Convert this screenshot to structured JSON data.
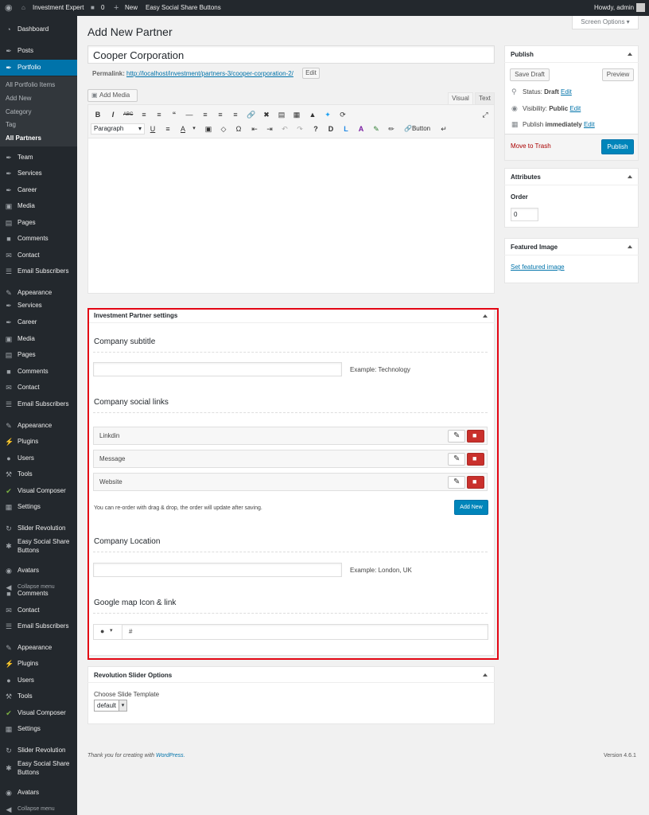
{
  "adminbar": {
    "site_name": "Investment Expert",
    "comments_count": "0",
    "new_label": "New",
    "plugin_link": "Easy Social Share Buttons",
    "howdy": "Howdy, admin"
  },
  "sidebar": {
    "items": [
      {
        "label": "Dashboard",
        "icon": "dashboard-icon"
      },
      {
        "label": "Posts",
        "icon": "pin-icon"
      },
      {
        "label": "Portfolio",
        "icon": "pin-icon"
      },
      {
        "label": "Team",
        "icon": "pin-icon"
      },
      {
        "label": "Services",
        "icon": "pin-icon"
      },
      {
        "label": "Career",
        "icon": "pin-icon"
      },
      {
        "label": "Media",
        "icon": "media-icon"
      },
      {
        "label": "Pages",
        "icon": "pages-icon"
      },
      {
        "label": "Comments",
        "icon": "comments-icon"
      },
      {
        "label": "Contact",
        "icon": "mail-icon"
      },
      {
        "label": "Email Subscribers",
        "icon": "list-icon"
      },
      {
        "label": "Appearance",
        "icon": "brush-icon"
      },
      {
        "label": "Services",
        "icon": "pin-icon"
      },
      {
        "label": "Career",
        "icon": "pin-icon"
      },
      {
        "label": "Media",
        "icon": "media-icon"
      },
      {
        "label": "Pages",
        "icon": "pages-icon"
      },
      {
        "label": "Comments",
        "icon": "comments-icon"
      },
      {
        "label": "Contact",
        "icon": "mail-icon"
      },
      {
        "label": "Email Subscribers",
        "icon": "list-icon"
      },
      {
        "label": "Appearance",
        "icon": "brush-icon"
      },
      {
        "label": "Plugins",
        "icon": "plug-icon"
      },
      {
        "label": "Users",
        "icon": "user-icon"
      },
      {
        "label": "Tools",
        "icon": "wrench-icon"
      },
      {
        "label": "Visual Composer",
        "icon": "vc-icon"
      },
      {
        "label": "Settings",
        "icon": "settings-icon"
      },
      {
        "label": "Slider Revolution",
        "icon": "refresh-icon"
      },
      {
        "label": "Easy Social Share",
        "label2": "Buttons",
        "icon": "share-icon"
      },
      {
        "label": "Avatars",
        "icon": "avatar-icon"
      },
      {
        "label": "Collapse menu",
        "icon": "collapse-icon"
      },
      {
        "label": "Comments",
        "icon": "comments-icon"
      },
      {
        "label": "Contact",
        "icon": "mail-icon"
      },
      {
        "label": "Email Subscribers",
        "icon": "list-icon"
      },
      {
        "label": "Appearance",
        "icon": "brush-icon"
      },
      {
        "label": "Plugins",
        "icon": "plug-icon"
      },
      {
        "label": "Users",
        "icon": "user-icon"
      },
      {
        "label": "Tools",
        "icon": "wrench-icon"
      },
      {
        "label": "Visual Composer",
        "icon": "vc-icon"
      },
      {
        "label": "Settings",
        "icon": "settings-icon"
      },
      {
        "label": "Slider Revolution",
        "icon": "refresh-icon"
      },
      {
        "label": "Easy Social Share",
        "label2": "Buttons",
        "icon": "share-icon"
      },
      {
        "label": "Avatars",
        "icon": "avatar-icon"
      },
      {
        "label": "Collapse menu",
        "icon": "collapse-icon"
      }
    ],
    "portfolio_sub": [
      "All Portfolio Items",
      "Add New",
      "Category",
      "Tag",
      "All Partners"
    ]
  },
  "page": {
    "title": "Add New Partner",
    "screen_options": "Screen Options"
  },
  "editor": {
    "post_title": "Cooper Corporation",
    "permalink_label": "Permalink:",
    "permalink_url": "http://localhost/investment/partners-3/cooper-corporation-2/",
    "edit_btn": "Edit",
    "add_media": "Add Media",
    "tab_visual": "Visual",
    "tab_text": "Text",
    "format_select": "Paragraph",
    "button_label": "Button"
  },
  "partner_settings": {
    "title": "Investment Partner settings",
    "subtitle_heading": "Company subtitle",
    "subtitle_value": "",
    "subtitle_example": "Example: Technology",
    "social_heading": "Company social links",
    "social_links": [
      "Linkdin",
      "Message",
      "Website"
    ],
    "reorder_note": "You can re-order with drag & drop, the order will update after saving.",
    "add_new": "Add New",
    "location_heading": "Company Location",
    "location_value": "",
    "location_example": "Example: London, UK",
    "map_heading": "Google map Icon & link",
    "map_link_value": "#"
  },
  "revslider": {
    "title": "Revolution Slider Options",
    "choose_label": "Choose Slide Template",
    "selected": "default"
  },
  "publish": {
    "title": "Publish",
    "save_draft": "Save Draft",
    "preview": "Preview",
    "status_label": "Status:",
    "status_value": "Draft",
    "visibility_label": "Visibility:",
    "visibility_value": "Public",
    "publish_label": "Publish",
    "publish_value": "immediately",
    "edit": "Edit",
    "trash": "Move to Trash",
    "publish_btn": "Publish"
  },
  "attributes": {
    "title": "Attributes",
    "order_label": "Order",
    "order_value": "0"
  },
  "featured": {
    "title": "Featured Image",
    "set_link": "Set featured image"
  },
  "footer": {
    "thanks": "Thank you for creating with",
    "wp": "WordPress.",
    "version": "Version 4.6.1"
  },
  "colors": {
    "accent": "#0073aa",
    "primary_btn": "#0085ba",
    "highlight": "#e30613",
    "sidebar_bg": "#23282d",
    "active_menu": "#0073aa",
    "delete_btn": "#c9302c"
  }
}
